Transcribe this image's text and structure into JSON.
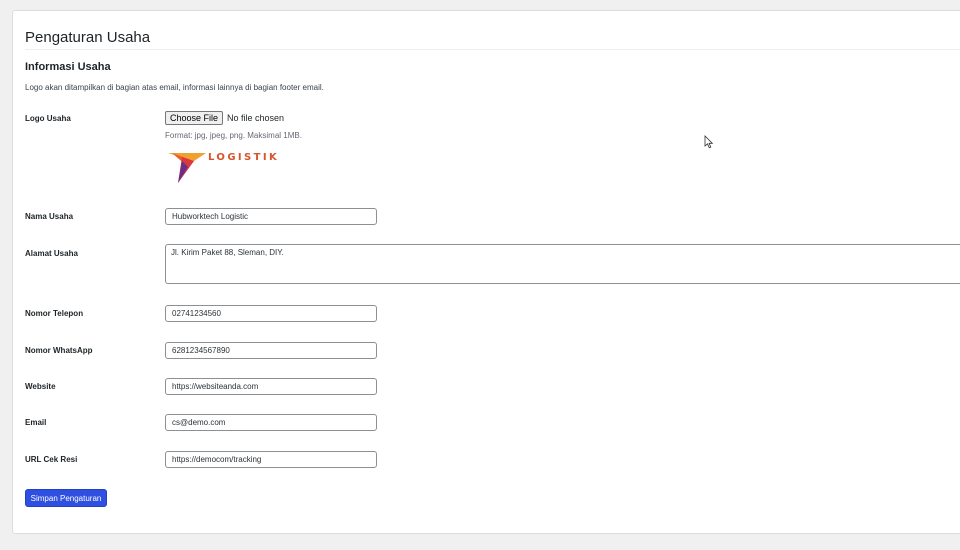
{
  "page": {
    "title": "Pengaturan Usaha"
  },
  "section": {
    "title": "Informasi Usaha",
    "description": "Logo akan ditampilkan di bagian atas email, informasi lainnya di bagian footer email."
  },
  "logo": {
    "label": "Logo Usaha",
    "button_label": "Choose File",
    "status": "No file chosen",
    "hint": "Format: jpg, jpeg, png. Maksimal 1MB.",
    "image_text": "LOGISTIK",
    "colors": {
      "text": "#d8542a",
      "mark_top": "#f0a030",
      "mark_mid": "#d63a3a",
      "mark_bottom": "#6a2d8c"
    }
  },
  "fields": {
    "nama_usaha": {
      "label": "Nama Usaha",
      "value": "Hubworktech Logistic"
    },
    "alamat_usaha": {
      "label": "Alamat Usaha",
      "value": "Jl. Kirim Paket 88, Sleman, DIY."
    },
    "nomor_telepon": {
      "label": "Nomor Telepon",
      "value": "02741234560"
    },
    "nomor_whatsapp": {
      "label": "Nomor WhatsApp",
      "value": "6281234567890"
    },
    "website": {
      "label": "Website",
      "value": "https://websiteanda.com"
    },
    "email": {
      "label": "Email",
      "value": "cs@demo.com"
    },
    "url_cek_resi": {
      "label": "URL Cek Resi",
      "value": "https://democom/tracking"
    }
  },
  "actions": {
    "submit_label": "Simpan Pengaturan"
  },
  "theme": {
    "accent": "#2f4fe0",
    "background": "#f0f0f1",
    "panel": "#ffffff"
  },
  "icons": {
    "cursor": "mouse-pointer-icon"
  }
}
